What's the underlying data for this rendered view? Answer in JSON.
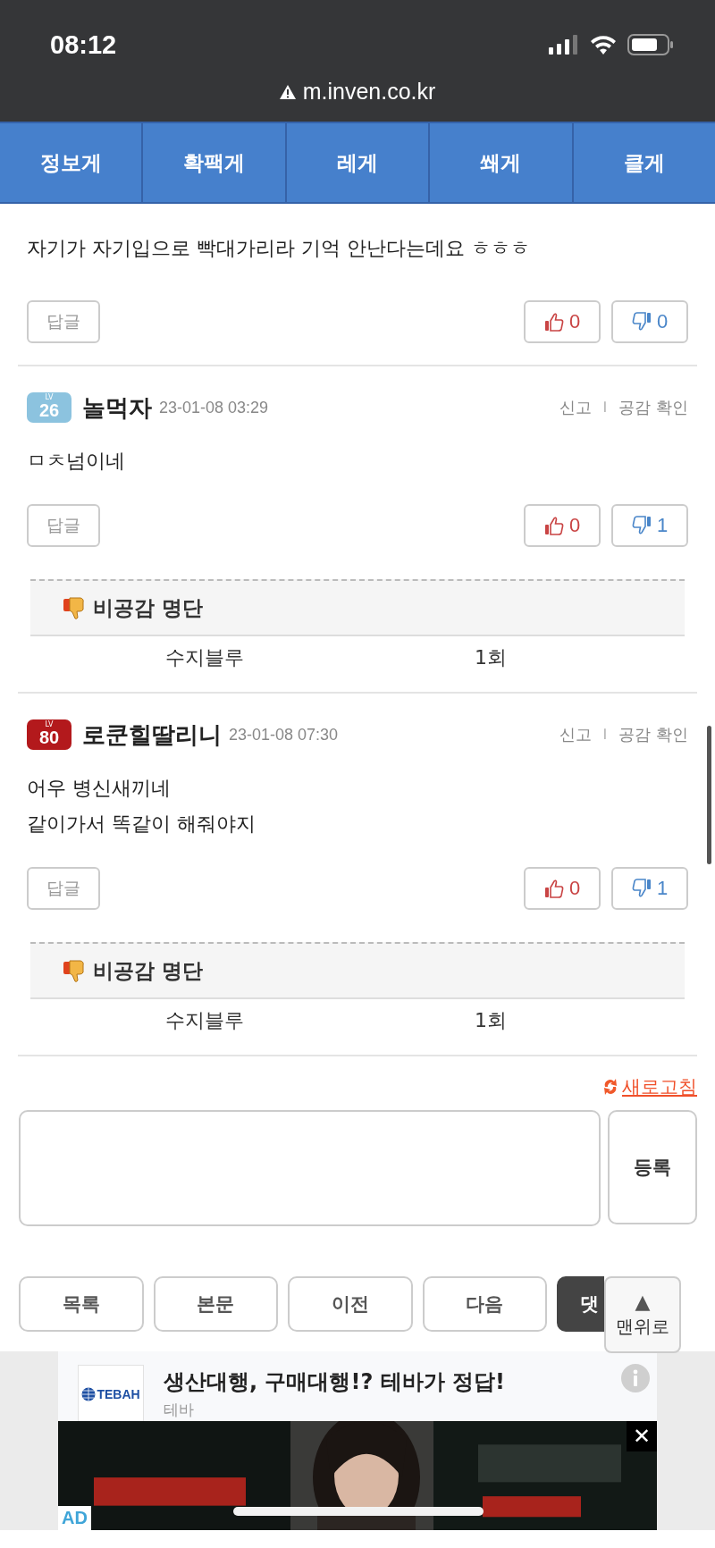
{
  "status_bar": {
    "time": "08:12"
  },
  "browser": {
    "url": "m.inven.co.kr"
  },
  "nav_tabs": [
    {
      "label": "정보게"
    },
    {
      "label": "확팩게"
    },
    {
      "label": "레게"
    },
    {
      "label": "쐐게"
    },
    {
      "label": "클게"
    }
  ],
  "comments": [
    {
      "text_lines": [
        "자기가 자기입으로 빡대가리라 기억 안난다는데요 ㅎㅎㅎ"
      ],
      "reply": "답글",
      "likes": "0",
      "dislikes": "0"
    },
    {
      "level_label": "LV",
      "level": "26",
      "color": "#8cc3df",
      "author": "놀먹자",
      "date": "23-01-08 03:29",
      "report": "신고",
      "separator": "ㅣ",
      "check": "공감 확인",
      "text_lines": [
        "ㅁㅊ넘이네"
      ],
      "reply": "답글",
      "likes": "0",
      "dislikes": "1",
      "dislike_list": {
        "title": "비공감 명단",
        "rows": [
          {
            "name": "수지블루",
            "count": "1회"
          }
        ]
      }
    },
    {
      "level_label": "LV",
      "level": "80",
      "color": "#b3191c",
      "author": "로쿤힐딸리니",
      "date": "23-01-08 07:30",
      "report": "신고",
      "separator": "ㅣ",
      "check": "공감 확인",
      "text_lines": [
        "어우 병신새끼네",
        "같이가서 똑같이 해줘야지"
      ],
      "reply": "답글",
      "likes": "0",
      "dislikes": "1",
      "dislike_list": {
        "title": "비공감 명단",
        "rows": [
          {
            "name": "수지블루",
            "count": "1회"
          }
        ]
      }
    }
  ],
  "refresh": {
    "label": "새로고침"
  },
  "comment_form": {
    "submit": "등록"
  },
  "bottom_nav": [
    {
      "label": "목록",
      "kind": "plain"
    },
    {
      "label": "본문",
      "kind": "plain"
    },
    {
      "label": "이전",
      "kind": "plain"
    },
    {
      "label": "다음",
      "kind": "plain"
    },
    {
      "label": "댓",
      "kind": "dark"
    }
  ],
  "scroll_top": {
    "arrow": "▲",
    "label": "맨위로"
  },
  "ad": {
    "logo": "TEBAH",
    "title": "생산대행, 구매대행!? 테바가 정답!",
    "source": "테바",
    "banner": {
      "kind": "picture",
      "close": "✕",
      "badge": "AD"
    }
  }
}
